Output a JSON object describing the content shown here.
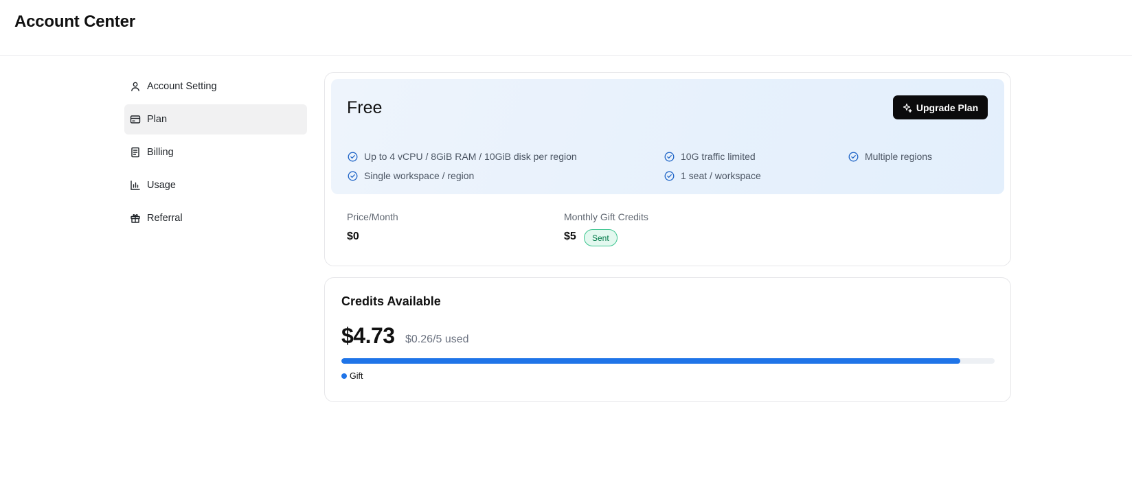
{
  "header": {
    "title": "Account Center"
  },
  "sidebar": {
    "items": [
      {
        "label": "Account Setting",
        "icon": "user-icon",
        "active": false
      },
      {
        "label": "Plan",
        "icon": "credit-card-icon",
        "active": true
      },
      {
        "label": "Billing",
        "icon": "receipt-icon",
        "active": false
      },
      {
        "label": "Usage",
        "icon": "bar-chart-icon",
        "active": false
      },
      {
        "label": "Referral",
        "icon": "gift-icon",
        "active": false
      }
    ]
  },
  "plan": {
    "name": "Free",
    "upgrade_label": "Upgrade Plan",
    "features": [
      "Up to 4 vCPU / 8GiB RAM / 10GiB disk per region",
      "10G traffic limited",
      "Multiple regions",
      "Single workspace / region",
      "1 seat / workspace"
    ],
    "price_label": "Price/Month",
    "price_value": "$0",
    "gift_label": "Monthly Gift Credits",
    "gift_value": "$5",
    "gift_badge": "Sent"
  },
  "credits": {
    "title": "Credits Available",
    "amount": "$4.73",
    "used_text": "$0.26/5 used",
    "progress_fraction": 0.947,
    "legend_label": "Gift"
  },
  "colors": {
    "accent": "#1f74e8",
    "badge_bg": "#e3f8ef",
    "badge_border": "#3cc58f",
    "button_bg": "#0b0b0c",
    "check": "#1d63c6"
  }
}
